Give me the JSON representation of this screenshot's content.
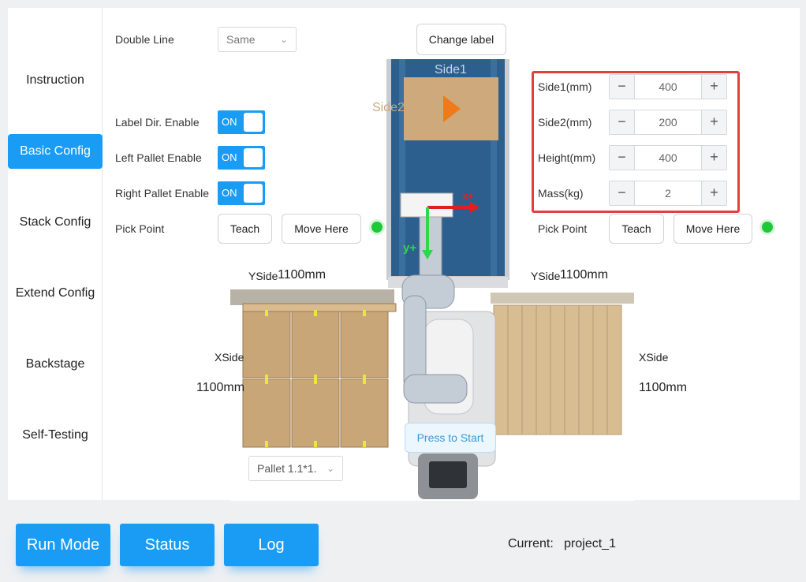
{
  "sidebar": {
    "items": [
      {
        "label": "Instruction"
      },
      {
        "label": "Basic Config"
      },
      {
        "label": "Stack Config"
      },
      {
        "label": "Extend Config"
      },
      {
        "label": "Backstage"
      },
      {
        "label": "Self-Testing"
      }
    ],
    "active_index": 1
  },
  "top": {
    "double_line_label": "Double Line",
    "double_line_value": "Same",
    "change_label_button": "Change label"
  },
  "toggles": [
    {
      "label": "Label Dir. Enable",
      "state": "ON"
    },
    {
      "label": "Left Pallet Enable",
      "state": "ON"
    },
    {
      "label": "Right Pallet Enable",
      "state": "ON"
    }
  ],
  "pick_left": {
    "label": "Pick Point",
    "teach": "Teach",
    "move": "Move Here",
    "status_color": "#1ec938"
  },
  "pick_right": {
    "label": "Pick Point",
    "teach": "Teach",
    "move": "Move Here",
    "status_color": "#1ec938"
  },
  "dimensions": [
    {
      "label": "Side1(mm)",
      "value": "400"
    },
    {
      "label": "Side2(mm)",
      "value": "200"
    },
    {
      "label": "Height(mm)",
      "value": "400"
    },
    {
      "label": "Mass(kg)",
      "value": "2"
    }
  ],
  "stepper_icons": {
    "minus": "−",
    "plus": "+"
  },
  "scene": {
    "side1": "Side1",
    "side2": "Side2",
    "x_axis": "x+",
    "y_axis": "y+",
    "yside_left": "YSide",
    "yside_left_value": "1100mm",
    "yside_right": "YSide",
    "yside_right_value": "1100mm",
    "xside_left": "XSide",
    "xside_left_value": "1100mm",
    "xside_right": "XSide",
    "xside_right_value": "1100mm",
    "press_to_start": "Press to Start",
    "pallet_select": "Pallet 1.1*1."
  },
  "bottom": {
    "run_mode": "Run Mode",
    "status": "Status",
    "log": "Log",
    "current_label": "Current:",
    "current_value": "project_1"
  },
  "colors": {
    "accent": "#1a9cf5",
    "highlight_border": "#e53e3e",
    "ok": "#1ec938"
  }
}
